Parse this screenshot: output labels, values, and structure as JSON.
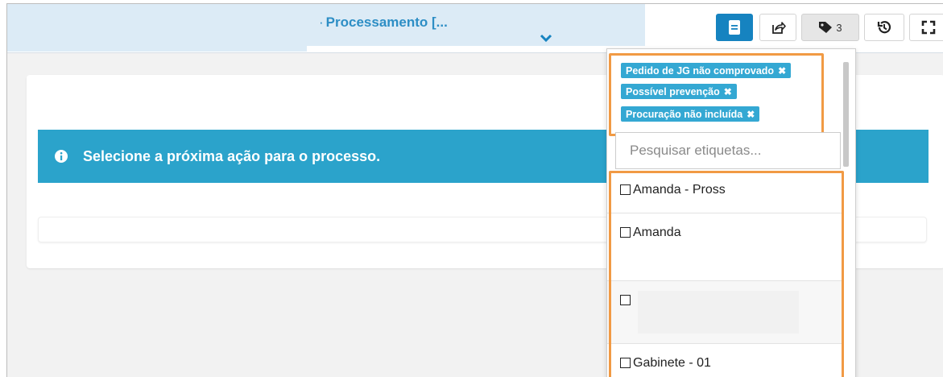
{
  "header": {
    "process_title": "Processamento [...",
    "title_prefix": "·",
    "buttons": [
      {
        "name": "document",
        "icon": "document-icon"
      },
      {
        "name": "share",
        "icon": "share-icon"
      },
      {
        "name": "tags",
        "icon": "tag-icon",
        "count": "3"
      },
      {
        "name": "history",
        "icon": "history-icon"
      },
      {
        "name": "fullscreen",
        "icon": "fullscreen-icon"
      }
    ]
  },
  "main": {
    "alert_message": "Selecione a próxima ação para o processo.",
    "alert_icon": "info-icon",
    "alert_color": "#2ba3cb"
  },
  "tags_dropdown": {
    "selected_tags": [
      "Pedido de JG não comprovado",
      "Possível prevenção",
      "Procuração não incluída"
    ],
    "remove_symbol": "✖",
    "search_placeholder": "Pesquisar etiquetas...",
    "search_value": "",
    "options": [
      {
        "label": "Amanda - Pross",
        "checked": false
      },
      {
        "label": "Amanda",
        "checked": false
      },
      {
        "label": "",
        "checked": false
      },
      {
        "label": "Gabinete - 01",
        "checked": false
      }
    ],
    "highlight_color": "#f19a44",
    "chip_color": "#34a8d3"
  }
}
